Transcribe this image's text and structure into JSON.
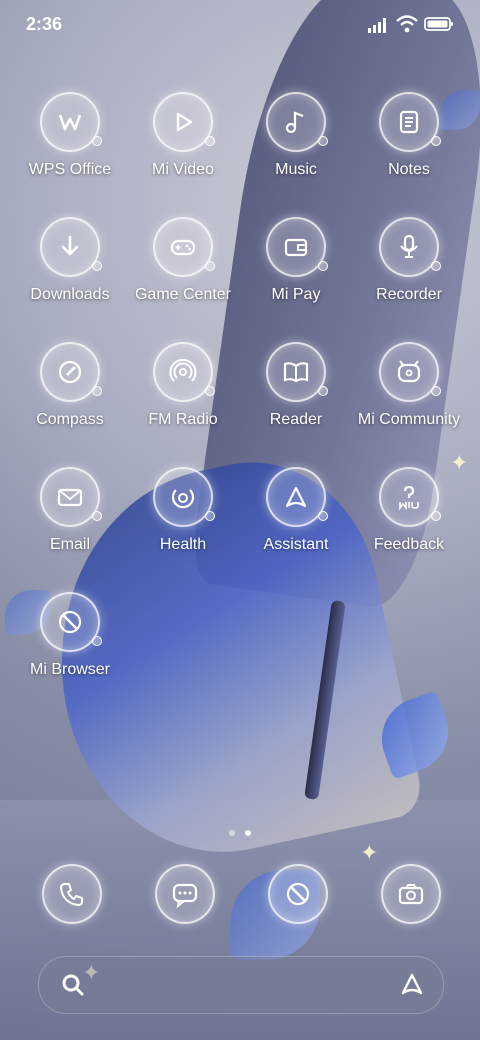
{
  "status": {
    "time": "2:36"
  },
  "apps": [
    {
      "label": "WPS Office",
      "icon": "wps-office-icon"
    },
    {
      "label": "Mi Video",
      "icon": "play-icon"
    },
    {
      "label": "Music",
      "icon": "music-note-icon"
    },
    {
      "label": "Notes",
      "icon": "notes-icon"
    },
    {
      "label": "Downloads",
      "icon": "download-arrow-icon"
    },
    {
      "label": "Game Center",
      "icon": "gamepad-icon"
    },
    {
      "label": "Mi Pay",
      "icon": "wallet-icon"
    },
    {
      "label": "Recorder",
      "icon": "microphone-icon"
    },
    {
      "label": "Compass",
      "icon": "compass-icon"
    },
    {
      "label": "FM Radio",
      "icon": "radio-icon"
    },
    {
      "label": "Reader",
      "icon": "book-icon"
    },
    {
      "label": "Mi Community",
      "icon": "community-icon"
    },
    {
      "label": "Email",
      "icon": "envelope-icon"
    },
    {
      "label": "Health",
      "icon": "health-icon"
    },
    {
      "label": "Assistant",
      "icon": "assistant-icon"
    },
    {
      "label": "Feedback",
      "icon": "feedback-icon"
    },
    {
      "label": "Mi Browser",
      "icon": "browser-icon"
    }
  ],
  "dock": [
    {
      "icon": "phone-icon"
    },
    {
      "icon": "chat-bubble-icon"
    },
    {
      "icon": "browser-icon"
    },
    {
      "icon": "camera-icon"
    }
  ],
  "page_indicator": {
    "count": 2,
    "active": 2
  }
}
